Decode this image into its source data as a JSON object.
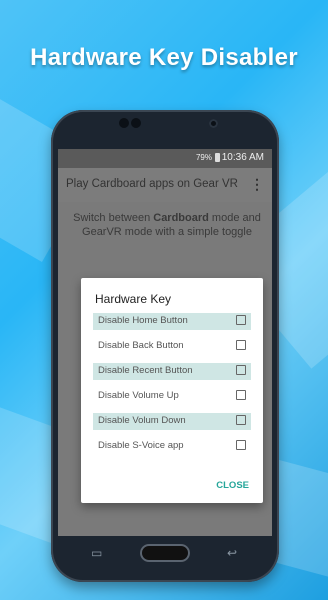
{
  "hero": {
    "title": "Hardware Key Disabler"
  },
  "status_bar": {
    "battery": "79%",
    "time": "10:36 AM"
  },
  "app_bar": {
    "title": "Play Cardboard apps on Gear VR",
    "menu_icon": "more-vert-icon"
  },
  "description": {
    "prefix": "Switch between ",
    "bold1": "Cardboard",
    "middle": " mode and GearVR mode with a simple toggle"
  },
  "dialog": {
    "title": "Hardware Key",
    "options": [
      {
        "label": "Disable Home Button",
        "checked": false,
        "highlighted": true
      },
      {
        "label": "Disable Back Button",
        "checked": false,
        "highlighted": false
      },
      {
        "label": "Disable Recent Button",
        "checked": false,
        "highlighted": true
      },
      {
        "label": "Disable Volume Up",
        "checked": false,
        "highlighted": false
      },
      {
        "label": "Disable Volum Down",
        "checked": false,
        "highlighted": true
      },
      {
        "label": "Disable S-Voice app",
        "checked": false,
        "highlighted": false
      }
    ],
    "close_label": "CLOSE"
  },
  "colors": {
    "accent": "#26a69a",
    "highlight": "#cfe6e4",
    "background": "#29b6f6"
  }
}
